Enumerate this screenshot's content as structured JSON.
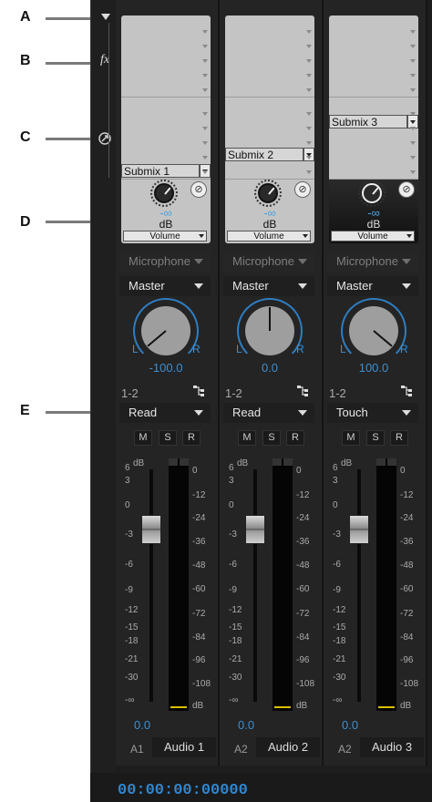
{
  "callouts": [
    "A",
    "B",
    "C",
    "D",
    "E"
  ],
  "icons": {
    "collapse": "triangle-down-icon",
    "fx": "fx-icon",
    "sends": "send-icon",
    "route": "routing-icon"
  },
  "control_strip": {
    "fx_label": "fx"
  },
  "tracks": [
    {
      "submix": "Submix 1",
      "inf": "-∞",
      "db_label": "dB",
      "volume_select": "Volume",
      "input": "Microphone",
      "output": "Master",
      "pan_left": "L",
      "pan_right": "R",
      "pan_value": "-100.0",
      "channel": "1-2",
      "automation": "Read",
      "mute": "M",
      "solo": "S",
      "record": "R",
      "fader_value": "0.0",
      "track_id": "A1",
      "track_name": "Audio 1"
    },
    {
      "submix": "Submix 2",
      "inf": "-∞",
      "db_label": "dB",
      "volume_select": "Volume",
      "input": "Microphone",
      "output": "Master",
      "pan_left": "L",
      "pan_right": "R",
      "pan_value": "0.0",
      "channel": "1-2",
      "automation": "Read",
      "mute": "M",
      "solo": "S",
      "record": "R",
      "fader_value": "0.0",
      "track_id": "A2",
      "track_name": "Audio 2"
    },
    {
      "submix": "Submix 3",
      "inf": "-∞",
      "db_label": "dB",
      "volume_select": "Volume",
      "input": "Microphone",
      "output": "Master",
      "pan_left": "L",
      "pan_right": "R",
      "pan_value": "100.0",
      "channel": "1-2",
      "automation": "Touch",
      "mute": "M",
      "solo": "S",
      "record": "R",
      "fader_value": "0.0",
      "track_id": "A2",
      "track_name": "Audio 3"
    }
  ],
  "fader_scale": [
    "dB",
    "6",
    "3",
    "0",
    "-3",
    "-6",
    "-9",
    "-12",
    "-15",
    "-18",
    "-21",
    "-30",
    "-∞"
  ],
  "meter_scale": [
    "0",
    "-12",
    "-24",
    "-36",
    "-48",
    "-60",
    "-72",
    "-84",
    "-96",
    "-108",
    "dB"
  ],
  "timecode": "00:00:00:00000"
}
